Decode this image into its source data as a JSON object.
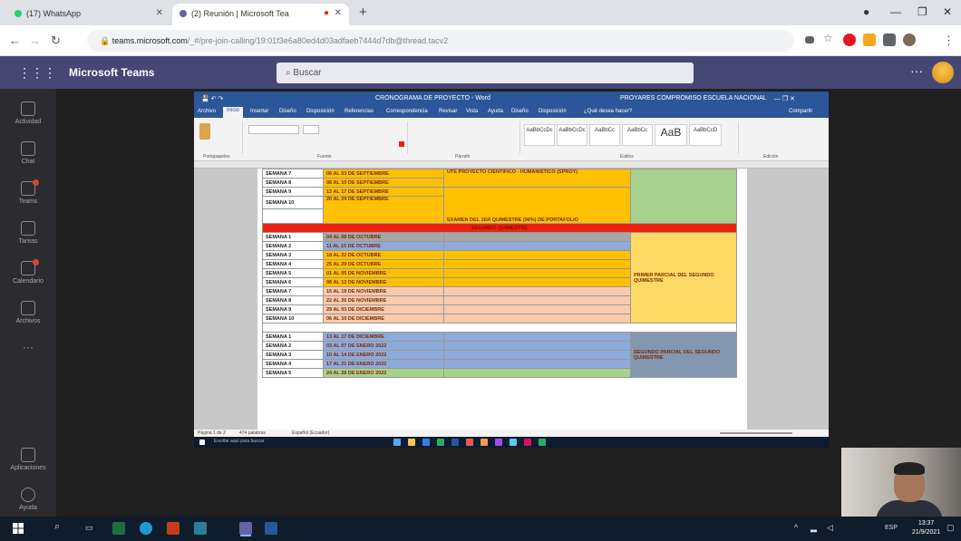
{
  "browser": {
    "tabs": [
      {
        "title": "(17) WhatsApp",
        "color": "#25d366"
      },
      {
        "title": "(2) Reunión | Microsoft Tea",
        "color": "#6264a7"
      }
    ],
    "url_host": "teams.microsoft.com",
    "url_path": "/_#/pre-join-calling/19:01f3e6a80ed4d03adfaeb7444d7db@thread.tacv2"
  },
  "teams": {
    "app_title": "Microsoft Teams",
    "search_placeholder": "Buscar",
    "rail": [
      {
        "label": "Actividad",
        "badge": false
      },
      {
        "label": "Chat",
        "badge": false
      },
      {
        "label": "Teams",
        "badge": true
      },
      {
        "label": "Tareas",
        "badge": false
      },
      {
        "label": "Calendario",
        "badge": true
      },
      {
        "label": "Archivos",
        "badge": false
      },
      {
        "label": "Aplicaciones",
        "badge": false
      },
      {
        "label": "Ayuda",
        "badge": false
      }
    ]
  },
  "word": {
    "doc_title": "CRONOGRAMA DE PROYECTO - Word",
    "account": "PROYARES COMPROMISO ESCUELA NACIONAL",
    "tabs": [
      "Archivo",
      "Inicio",
      "Insertar",
      "Diseño",
      "Disposición",
      "Referencias",
      "Correspondencia",
      "Revisar",
      "Vista",
      "Ayuda",
      "Diseño",
      "Disposición",
      "¿Qué desea hacer?"
    ],
    "share_label": "Compartir",
    "ribbon_groups": [
      "Portapapeles",
      "Fuente",
      "Párrafo",
      "Estilos",
      "Edición"
    ],
    "style_names": [
      "AaBbCcDc",
      "AaBbCcDc",
      "AaBbCc",
      "AaBbCc",
      "AaB",
      "AaBbCcD"
    ],
    "status_left": "Página 1 de 2",
    "status_words": "474 palabras",
    "status_lang": "Español (Ecuador)"
  },
  "schedule": {
    "block1": [
      {
        "sem": "SEMANA 7",
        "date": "06 AL 03 DE SEPTIEMBRE"
      },
      {
        "sem": "SEMANA 8",
        "date": "08 AL 10 DE SEPTIEMBRE"
      },
      {
        "sem": "SEMANA 9",
        "date": "13 AL 17 DE SEPTIEMBRE"
      },
      {
        "sem": "SEMANA 10",
        "date": "20 AL 24 DE SEPTIEMBRE"
      }
    ],
    "block1_desc_a": "UTE PROYECTO CIENTÍFICO - HUMANÍSTICO (SPROY)",
    "block1_desc_b": "EXAMEN DEL 1ER QUIMESTRE (96%) DE PORTAFOLIO",
    "band_label": "SEGUNDO QUIMESTRE",
    "block2": [
      {
        "sem": "SEMANA 1",
        "date": "04 AL 08 DE OCTUBRE",
        "color": "#a6a6a6"
      },
      {
        "sem": "SEMANA 2",
        "date": "11 AL 15 DE OCTUBRE",
        "color": "#8eaadb"
      },
      {
        "sem": "SEMANA 3",
        "date": "18 AL 22 DE OCTUBRE",
        "color": "#ffc000"
      },
      {
        "sem": "SEMANA 4",
        "date": "25 AL 29 DE OCTUBRE",
        "color": "#ffc000"
      },
      {
        "sem": "SEMANA 5",
        "date": "01 AL 05 DE NOVIEMBRE",
        "color": "#ffc000"
      },
      {
        "sem": "SEMANA 6",
        "date": "08 AL 12 DE NOVIEMBRE",
        "color": "#ffc000"
      },
      {
        "sem": "SEMANA 7",
        "date": "15 AL 19 DE NOVIEMBRE",
        "color": "#f8cbad"
      },
      {
        "sem": "SEMANA 8",
        "date": "22 AL 26 DE NOVIEMBRE",
        "color": "#f8cbad"
      },
      {
        "sem": "SEMANA 9",
        "date": "29 AL 03 DE DICIEMBRE",
        "color": "#f8cbad"
      },
      {
        "sem": "SEMANA 10",
        "date": "06 AL 10 DE DICIEMBRE",
        "color": "#f8cbad"
      }
    ],
    "block2_side": "PRIMER PARCIAL DEL SEGUNDO QUIMESTRE",
    "block3": [
      {
        "sem": "SEMANA 1",
        "date": "13 AL 17 DE DICIEMBRE",
        "color": "#8eaadb"
      },
      {
        "sem": "SEMANA 2",
        "date": "03 AL 07 DE ENERO 2022",
        "color": "#8eaadb"
      },
      {
        "sem": "SEMANA 3",
        "date": "10 AL 14 DE ENERO 2022",
        "color": "#8eaadb"
      },
      {
        "sem": "SEMANA 4",
        "date": "17 AL 21 DE ENERO 2022",
        "color": "#8eaadb"
      },
      {
        "sem": "SEMANA 5",
        "date": "24 AL 28 DE ENERO 2022",
        "color": "#a9d18e"
      }
    ],
    "block3_side": "SEGUNDO PARCIAL DEL SEGUNDO QUIMESTRE"
  },
  "remote_taskbar": {
    "search": "Escribe aquí para buscar"
  },
  "windows": {
    "time": "13:37",
    "date": "21/9/2021",
    "lang": "ESP"
  }
}
